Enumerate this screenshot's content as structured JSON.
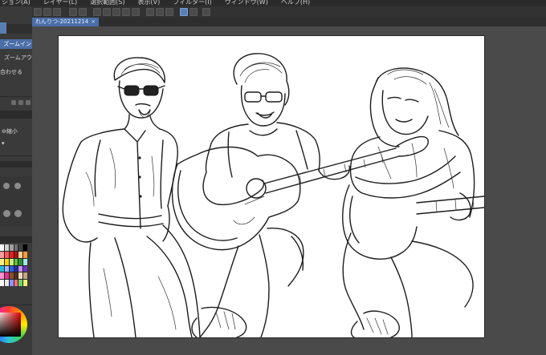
{
  "menubar": {
    "items": [
      "ション(A)",
      "レイヤー(L)",
      "選択範囲(S)",
      "表示(V)",
      "フィルター(I)",
      "ウィンドウ(W)",
      "ヘルプ(H)"
    ]
  },
  "document_tab": {
    "label": "れんりつ-20211214",
    "close_glyph": "×"
  },
  "left_panel": {
    "zoom_in_label": "ズームイン",
    "zoom_out_label": "ズームアウト",
    "fit_label": "合わせる",
    "shrink_label": "縮小"
  },
  "colors": {
    "accent": "#4b6ea8",
    "panel_bg": "#3a3a3a",
    "canvas_bg": "#4a4a4a",
    "paper": "#ffffff",
    "swatches": [
      "#ffffff",
      "#d0d0d0",
      "#a0a0a0",
      "#707070",
      "#404040",
      "#000000",
      "#ff9a9a",
      "#ff5a5a",
      "#e02020",
      "#b01010",
      "#ffcc99",
      "#ff9933",
      "#ffee88",
      "#ffd000",
      "#c8f080",
      "#60c040",
      "#2f8f2f",
      "#a0e8e8",
      "#30b8d8",
      "#9ab8ff",
      "#3060e0",
      "#2030a0",
      "#c090ff",
      "#7030c0",
      "#ff90d0",
      "#e03090",
      "#8a5030",
      "#503020",
      "#f0d8c0",
      "#c8a080",
      "#ffffff",
      "#e8e8e8",
      "#9090ff",
      "#ff7070",
      "#70d070",
      "#f0f070"
    ]
  },
  "icons": {
    "toolbar": [
      "new-icon",
      "open-icon",
      "save-icon",
      "undo-icon",
      "redo-icon",
      "clear-icon",
      "transform-icon",
      "fill-icon",
      "snap-icon",
      "ruler-icon",
      "grid-icon",
      "fit-icon"
    ]
  }
}
